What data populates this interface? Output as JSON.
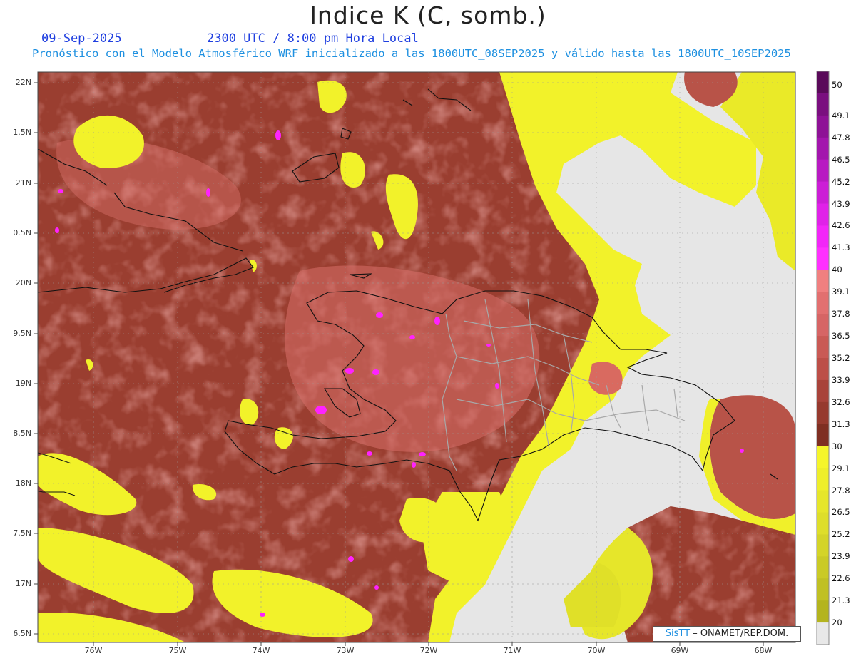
{
  "header": {
    "title": "Indice K (C, somb.)",
    "date": "09-Sep-2025",
    "time": "2300 UTC / 8:00 pm Hora Local",
    "description": "Pronóstico con el Modelo Atmosférico WRF inicializado a las 1800UTC_08SEP2025 y válido hasta las  1800UTC_10SEP2025"
  },
  "map": {
    "lat_labels": [
      "22N",
      "1.5N",
      "21N",
      "0.5N",
      "20N",
      "9.5N",
      "19N",
      "8.5N",
      "18N",
      "7.5N",
      "17N",
      "6.5N"
    ],
    "lon_labels": [
      "76W",
      "75W",
      "74W",
      "73W",
      "72W",
      "71W",
      "70W",
      "69W",
      "68W"
    ],
    "credit_brand": "SisTT",
    "credit_rest": " – ONAMET/REP.DOM."
  },
  "colorbar": {
    "labels": [
      "50",
      "49.1",
      "47.8",
      "46.5",
      "45.2",
      "43.9",
      "42.6",
      "41.3",
      "40",
      "39.1",
      "37.8",
      "36.5",
      "35.2",
      "33.9",
      "32.6",
      "31.3",
      "30",
      "29.1",
      "27.8",
      "26.5",
      "25.2",
      "23.9",
      "22.6",
      "21.3",
      "20"
    ],
    "colors": [
      "#5a0a5a",
      "#7a0f7f",
      "#8e1296",
      "#a316ad",
      "#b81ac2",
      "#cc1ed6",
      "#e022e8",
      "#f226f8",
      "#ff30ff",
      "#f08080",
      "#e27070",
      "#d66565",
      "#c95a55",
      "#bc4f48",
      "#a8433a",
      "#963a2e",
      "#7f2f22",
      "#f5f52a",
      "#eeee2a",
      "#e6e62a",
      "#dede2a",
      "#d4d428",
      "#caca26",
      "#c0c024",
      "#b4b41f",
      "#e8e8e8"
    ]
  }
}
